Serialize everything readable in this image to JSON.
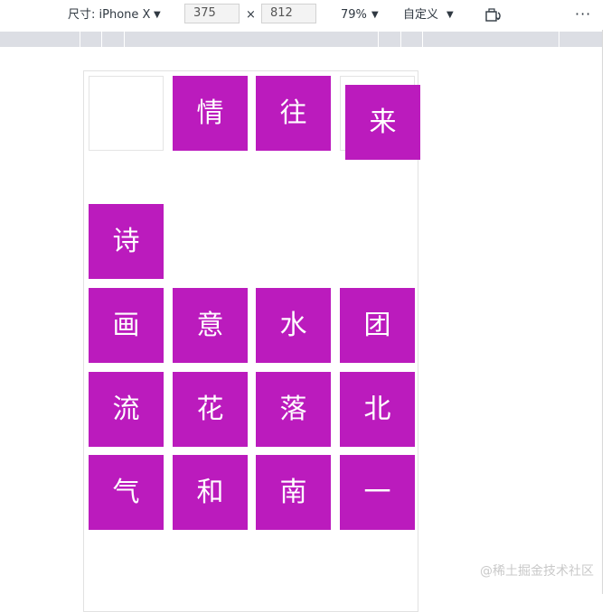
{
  "toolbar": {
    "dimensions_label": "尺寸: iPhone X",
    "width_value": "375",
    "times_symbol": "×",
    "height_value": "812",
    "zoom_label": "79%",
    "throttle_label": "自定义",
    "caret": "▼",
    "more_label": "⋮"
  },
  "grid": {
    "tiles": [
      "情",
      "往",
      "来",
      "诗",
      "画",
      "意",
      "水",
      "团",
      "流",
      "花",
      "落",
      "北",
      "气",
      "和",
      "南",
      "一"
    ]
  },
  "watermark": "@稀土掘金技术社区",
  "colors": {
    "tile_bg": "#bb1bbd",
    "tile_text": "#ffffff",
    "ruler_bg": "#dcdee4"
  }
}
